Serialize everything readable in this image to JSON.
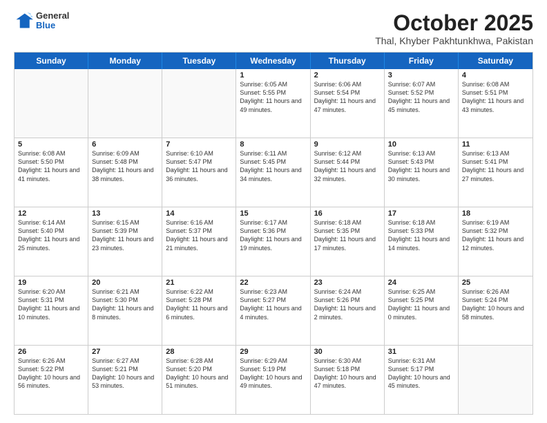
{
  "logo": {
    "general": "General",
    "blue": "Blue"
  },
  "header": {
    "title": "October 2025",
    "subtitle": "Thal, Khyber Pakhtunkhwa, Pakistan"
  },
  "days_of_week": [
    "Sunday",
    "Monday",
    "Tuesday",
    "Wednesday",
    "Thursday",
    "Friday",
    "Saturday"
  ],
  "weeks": [
    [
      {
        "day": "",
        "info": ""
      },
      {
        "day": "",
        "info": ""
      },
      {
        "day": "",
        "info": ""
      },
      {
        "day": "1",
        "info": "Sunrise: 6:05 AM\nSunset: 5:55 PM\nDaylight: 11 hours and 49 minutes."
      },
      {
        "day": "2",
        "info": "Sunrise: 6:06 AM\nSunset: 5:54 PM\nDaylight: 11 hours and 47 minutes."
      },
      {
        "day": "3",
        "info": "Sunrise: 6:07 AM\nSunset: 5:52 PM\nDaylight: 11 hours and 45 minutes."
      },
      {
        "day": "4",
        "info": "Sunrise: 6:08 AM\nSunset: 5:51 PM\nDaylight: 11 hours and 43 minutes."
      }
    ],
    [
      {
        "day": "5",
        "info": "Sunrise: 6:08 AM\nSunset: 5:50 PM\nDaylight: 11 hours and 41 minutes."
      },
      {
        "day": "6",
        "info": "Sunrise: 6:09 AM\nSunset: 5:48 PM\nDaylight: 11 hours and 38 minutes."
      },
      {
        "day": "7",
        "info": "Sunrise: 6:10 AM\nSunset: 5:47 PM\nDaylight: 11 hours and 36 minutes."
      },
      {
        "day": "8",
        "info": "Sunrise: 6:11 AM\nSunset: 5:45 PM\nDaylight: 11 hours and 34 minutes."
      },
      {
        "day": "9",
        "info": "Sunrise: 6:12 AM\nSunset: 5:44 PM\nDaylight: 11 hours and 32 minutes."
      },
      {
        "day": "10",
        "info": "Sunrise: 6:13 AM\nSunset: 5:43 PM\nDaylight: 11 hours and 30 minutes."
      },
      {
        "day": "11",
        "info": "Sunrise: 6:13 AM\nSunset: 5:41 PM\nDaylight: 11 hours and 27 minutes."
      }
    ],
    [
      {
        "day": "12",
        "info": "Sunrise: 6:14 AM\nSunset: 5:40 PM\nDaylight: 11 hours and 25 minutes."
      },
      {
        "day": "13",
        "info": "Sunrise: 6:15 AM\nSunset: 5:39 PM\nDaylight: 11 hours and 23 minutes."
      },
      {
        "day": "14",
        "info": "Sunrise: 6:16 AM\nSunset: 5:37 PM\nDaylight: 11 hours and 21 minutes."
      },
      {
        "day": "15",
        "info": "Sunrise: 6:17 AM\nSunset: 5:36 PM\nDaylight: 11 hours and 19 minutes."
      },
      {
        "day": "16",
        "info": "Sunrise: 6:18 AM\nSunset: 5:35 PM\nDaylight: 11 hours and 17 minutes."
      },
      {
        "day": "17",
        "info": "Sunrise: 6:18 AM\nSunset: 5:33 PM\nDaylight: 11 hours and 14 minutes."
      },
      {
        "day": "18",
        "info": "Sunrise: 6:19 AM\nSunset: 5:32 PM\nDaylight: 11 hours and 12 minutes."
      }
    ],
    [
      {
        "day": "19",
        "info": "Sunrise: 6:20 AM\nSunset: 5:31 PM\nDaylight: 11 hours and 10 minutes."
      },
      {
        "day": "20",
        "info": "Sunrise: 6:21 AM\nSunset: 5:30 PM\nDaylight: 11 hours and 8 minutes."
      },
      {
        "day": "21",
        "info": "Sunrise: 6:22 AM\nSunset: 5:28 PM\nDaylight: 11 hours and 6 minutes."
      },
      {
        "day": "22",
        "info": "Sunrise: 6:23 AM\nSunset: 5:27 PM\nDaylight: 11 hours and 4 minutes."
      },
      {
        "day": "23",
        "info": "Sunrise: 6:24 AM\nSunset: 5:26 PM\nDaylight: 11 hours and 2 minutes."
      },
      {
        "day": "24",
        "info": "Sunrise: 6:25 AM\nSunset: 5:25 PM\nDaylight: 11 hours and 0 minutes."
      },
      {
        "day": "25",
        "info": "Sunrise: 6:26 AM\nSunset: 5:24 PM\nDaylight: 10 hours and 58 minutes."
      }
    ],
    [
      {
        "day": "26",
        "info": "Sunrise: 6:26 AM\nSunset: 5:22 PM\nDaylight: 10 hours and 56 minutes."
      },
      {
        "day": "27",
        "info": "Sunrise: 6:27 AM\nSunset: 5:21 PM\nDaylight: 10 hours and 53 minutes."
      },
      {
        "day": "28",
        "info": "Sunrise: 6:28 AM\nSunset: 5:20 PM\nDaylight: 10 hours and 51 minutes."
      },
      {
        "day": "29",
        "info": "Sunrise: 6:29 AM\nSunset: 5:19 PM\nDaylight: 10 hours and 49 minutes."
      },
      {
        "day": "30",
        "info": "Sunrise: 6:30 AM\nSunset: 5:18 PM\nDaylight: 10 hours and 47 minutes."
      },
      {
        "day": "31",
        "info": "Sunrise: 6:31 AM\nSunset: 5:17 PM\nDaylight: 10 hours and 45 minutes."
      },
      {
        "day": "",
        "info": ""
      }
    ]
  ]
}
